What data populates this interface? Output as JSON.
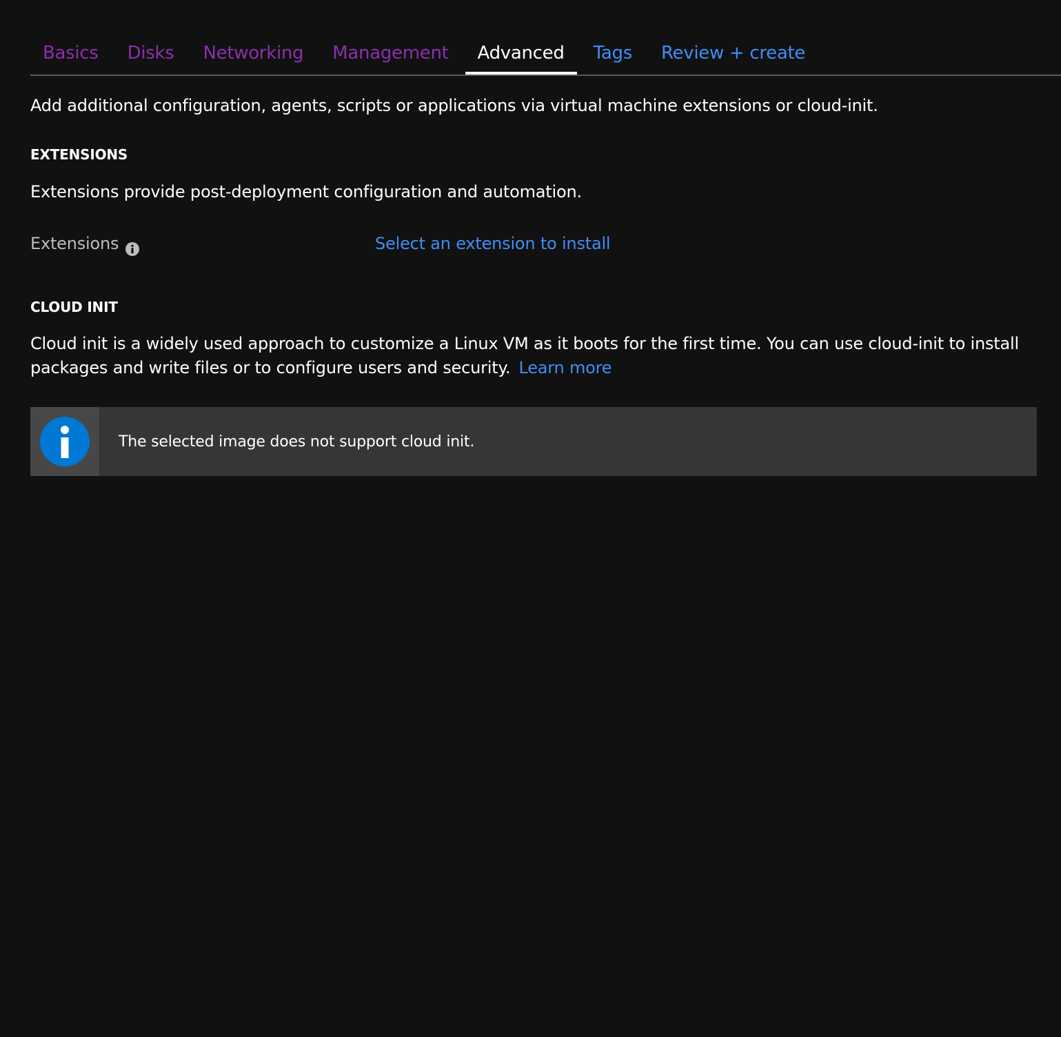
{
  "tabs": [
    {
      "label": "Basics",
      "state": "visited"
    },
    {
      "label": "Disks",
      "state": "visited"
    },
    {
      "label": "Networking",
      "state": "visited"
    },
    {
      "label": "Management",
      "state": "visited"
    },
    {
      "label": "Advanced",
      "state": "active"
    },
    {
      "label": "Tags",
      "state": "link"
    },
    {
      "label": "Review + create",
      "state": "link"
    }
  ],
  "intro": "Add additional configuration, agents, scripts or applications via virtual machine extensions or cloud-init.",
  "extensions": {
    "heading": "EXTENSIONS",
    "description": "Extensions provide post-deployment configuration and automation.",
    "field_label": "Extensions",
    "field_icon": "info-icon",
    "link": "Select an extension to install"
  },
  "cloud_init": {
    "heading": "CLOUD INIT",
    "description": "Cloud init is a widely used approach to customize a Linux VM as it boots for the first time. You can use cloud-init to install packages and write files or to configure users and security.",
    "learn_more": "Learn more",
    "banner_icon": "info-circle-icon",
    "banner_text": "The selected image does not support cloud init."
  },
  "colors": {
    "background": "#111111",
    "visited_tab": "#8b2fae",
    "link": "#3e8ef7",
    "info_blue": "#0078d4",
    "banner_bg": "#363636"
  }
}
